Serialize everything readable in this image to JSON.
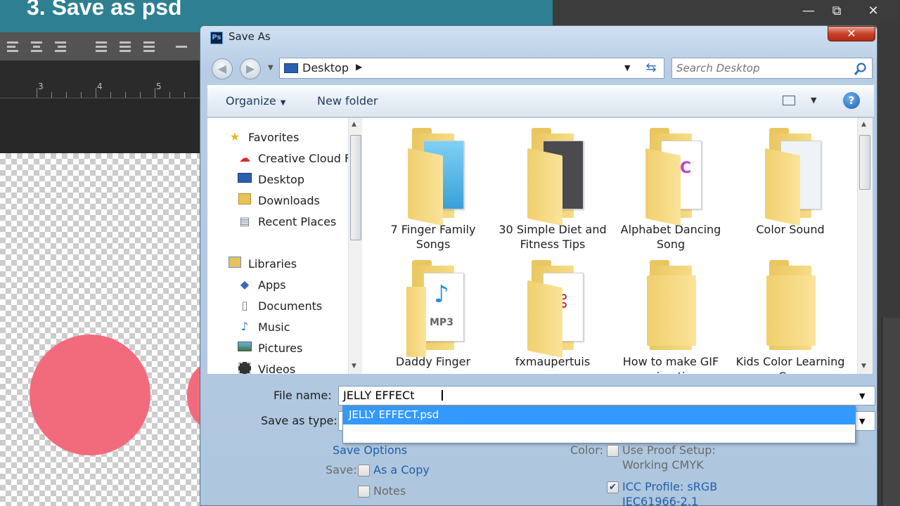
{
  "banner": {
    "title": "3. Save as psd"
  },
  "photoshop": {
    "ruler_marks": [
      "3",
      "4",
      "5"
    ],
    "window_controls": {
      "minimize": "—",
      "maximize": "⧉",
      "close": "✕"
    }
  },
  "dialog": {
    "title": "Save As",
    "title_icon": "Ps",
    "close_label": "✕",
    "address": {
      "location": "Desktop",
      "arrow": "▶"
    },
    "search": {
      "placeholder": "Search Desktop"
    },
    "toolbar": {
      "organize": "Organize",
      "new_folder": "New folder",
      "help": "?"
    },
    "nav": {
      "favorites": "Favorites",
      "creative_cloud": "Creative Cloud F",
      "desktop": "Desktop",
      "downloads": "Downloads",
      "recent_places": "Recent Places",
      "libraries": "Libraries",
      "apps": "Apps",
      "documents": "Documents",
      "music": "Music",
      "pictures": "Pictures",
      "videos": "Videos"
    },
    "files": [
      {
        "name": "7 Finger Family Songs"
      },
      {
        "name": "30 Simple Diet and Fitness Tips"
      },
      {
        "name": "Alphabet Dancing Song"
      },
      {
        "name": "Color Sound"
      },
      {
        "name": "Daddy Finger"
      },
      {
        "name": "fxmaupertuis"
      },
      {
        "name": "How to make GIF animation"
      },
      {
        "name": "Kids Color Learning Cow"
      }
    ],
    "mp3_label": "MP3",
    "form": {
      "file_name_label": "File name:",
      "file_name_value": "JELLY EFFECt",
      "save_as_type_label": "Save as type:",
      "autocomplete_option": "JELLY EFFECT.psd",
      "save_options": "Save Options",
      "save_label": "Save:",
      "as_a_copy": "As a Copy",
      "notes": "Notes",
      "color_label": "Color:",
      "use_proof_setup": "Use Proof Setup:",
      "working_cmyk": "Working CMYK",
      "icc_profile": "ICC Profile:  sRGB",
      "icc_detail": "IEC61966-2.1"
    }
  },
  "colors": {
    "banner": "#2d7f91",
    "circle": "#f26b7c",
    "selection": "#3399ff"
  }
}
